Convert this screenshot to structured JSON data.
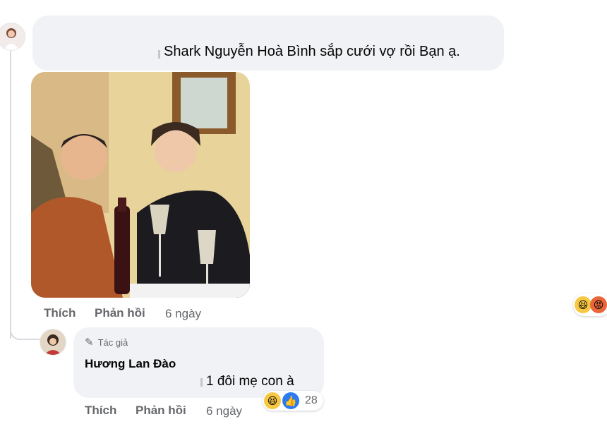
{
  "comment": {
    "text": "Shark Nguyễn Hoà Bình sắp cưới vợ rồi Bạn ạ.",
    "actions": {
      "like": "Thích",
      "reply": "Phản hồi",
      "time": "6 ngày"
    }
  },
  "reply": {
    "author_badge": "Tác giả",
    "author": "Hương Lan Đào",
    "text": "1 đôi mẹ con à",
    "actions": {
      "like": "Thích",
      "reply": "Phản hồi",
      "time": "6 ngày"
    },
    "reaction_count": "28"
  },
  "colors": {
    "bubble": "#f0f2f5",
    "meta": "#65676b",
    "like_blue": "#2b7bf3"
  },
  "icons": [
    "avatar",
    "pen-icon",
    "haha-reaction-icon",
    "like-reaction-icon",
    "angry-reaction-icon"
  ]
}
